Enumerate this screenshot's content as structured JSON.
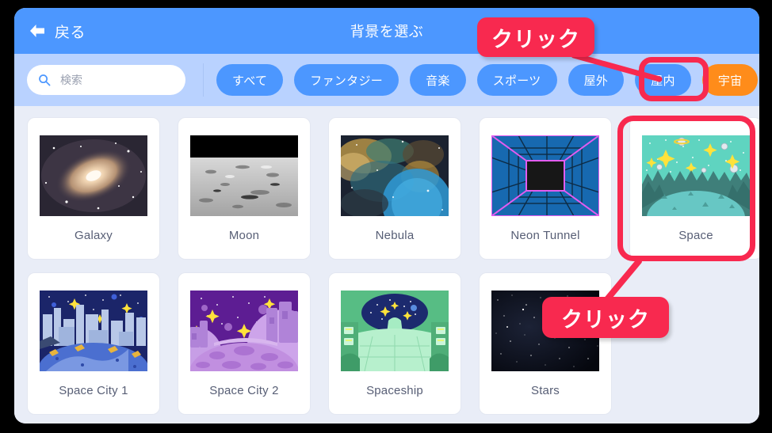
{
  "window": {
    "titlebar": {
      "back_label": "戻る",
      "back_icon": "arrow-left-icon",
      "title": "背景を選ぶ"
    },
    "filterbar": {
      "search": {
        "icon": "search-icon",
        "placeholder": "検索",
        "value": ""
      },
      "filters": [
        {
          "label": "すべて",
          "selected": false
        },
        {
          "label": "ファンタジー",
          "selected": false
        },
        {
          "label": "音楽",
          "selected": false
        },
        {
          "label": "スポーツ",
          "selected": false
        },
        {
          "label": "屋外",
          "selected": false
        },
        {
          "label": "屋内",
          "selected": false
        },
        {
          "label": "宇宙",
          "selected": true
        }
      ]
    },
    "grid": {
      "items": [
        {
          "label": "Galaxy",
          "thumb": "galaxy"
        },
        {
          "label": "Moon",
          "thumb": "moon"
        },
        {
          "label": "Nebula",
          "thumb": "nebula"
        },
        {
          "label": "Neon Tunnel",
          "thumb": "neon-tunnel"
        },
        {
          "label": "Space",
          "thumb": "space",
          "highlighted": true
        },
        {
          "label": "Space City 1",
          "thumb": "space-city-1"
        },
        {
          "label": "Space City 2",
          "thumb": "space-city-2"
        },
        {
          "label": "Spaceship",
          "thumb": "spaceship"
        },
        {
          "label": "Stars",
          "thumb": "stars"
        }
      ]
    }
  },
  "annotations": {
    "callout_top": "クリック",
    "callout_bottom": "クリック"
  },
  "colors": {
    "header_blue": "#4c97ff",
    "filterbar_blue": "#b9d2ff",
    "selected_chip_orange": "#ff8c1a",
    "annotation_red": "#f8294f",
    "grid_background": "#e9edf7",
    "label_text": "#575e75"
  }
}
